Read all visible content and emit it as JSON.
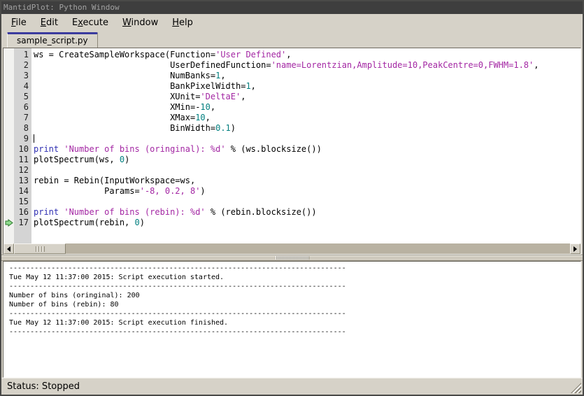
{
  "window": {
    "title": "MantidPlot: Python Window"
  },
  "menu_bar": {
    "items": [
      {
        "name": "file",
        "pre": "",
        "key": "F",
        "post": "ile"
      },
      {
        "name": "edit",
        "pre": "",
        "key": "E",
        "post": "dit"
      },
      {
        "name": "execute",
        "pre": "E",
        "key": "x",
        "post": "ecute"
      },
      {
        "name": "window",
        "pre": "",
        "key": "W",
        "post": "indow"
      },
      {
        "name": "help",
        "pre": "",
        "key": "H",
        "post": "elp"
      }
    ]
  },
  "tabs": {
    "active_label": "sample_script.py"
  },
  "editor": {
    "caret_line": 9,
    "execution_marker_line": 17,
    "colors": {
      "keyword": "#2f2fb2",
      "string": "#a326a3",
      "number": "#007f7f",
      "default": "#000000"
    },
    "lines": [
      {
        "n": 1,
        "seg": [
          [
            "c",
            "ws = CreateSampleWorkspace(Function="
          ],
          [
            "s",
            "'User Defined'"
          ],
          [
            "c",
            ","
          ]
        ]
      },
      {
        "n": 2,
        "seg": [
          [
            "c",
            "                           UserDefinedFunction="
          ],
          [
            "s",
            "'name=Lorentzian,Amplitude=10,PeakCentre=0,FWHM=1.8'"
          ],
          [
            "c",
            ","
          ]
        ]
      },
      {
        "n": 3,
        "seg": [
          [
            "c",
            "                           NumBanks="
          ],
          [
            "n",
            "1"
          ],
          [
            "c",
            ","
          ]
        ]
      },
      {
        "n": 4,
        "seg": [
          [
            "c",
            "                           BankPixelWidth="
          ],
          [
            "n",
            "1"
          ],
          [
            "c",
            ","
          ]
        ]
      },
      {
        "n": 5,
        "seg": [
          [
            "c",
            "                           XUnit="
          ],
          [
            "s",
            "'DeltaE'"
          ],
          [
            "c",
            ","
          ]
        ]
      },
      {
        "n": 6,
        "seg": [
          [
            "c",
            "                           XMin=-"
          ],
          [
            "n",
            "10"
          ],
          [
            "c",
            ","
          ]
        ]
      },
      {
        "n": 7,
        "seg": [
          [
            "c",
            "                           XMax="
          ],
          [
            "n",
            "10"
          ],
          [
            "c",
            ","
          ]
        ]
      },
      {
        "n": 8,
        "seg": [
          [
            "c",
            "                           BinWidth="
          ],
          [
            "n",
            "0.1"
          ],
          [
            "c",
            ")"
          ]
        ]
      },
      {
        "n": 9,
        "seg": [],
        "caret": true
      },
      {
        "n": 10,
        "seg": [
          [
            "k",
            "print"
          ],
          [
            "c",
            " "
          ],
          [
            "s",
            "'Number of bins (oringinal): %d'"
          ],
          [
            "c",
            " % (ws.blocksize())"
          ]
        ]
      },
      {
        "n": 11,
        "seg": [
          [
            "c",
            "plotSpectrum(ws, "
          ],
          [
            "n",
            "0"
          ],
          [
            "c",
            ")"
          ]
        ]
      },
      {
        "n": 12,
        "seg": []
      },
      {
        "n": 13,
        "seg": [
          [
            "c",
            "rebin = Rebin(InputWorkspace=ws,"
          ]
        ]
      },
      {
        "n": 14,
        "seg": [
          [
            "c",
            "              Params="
          ],
          [
            "s",
            "'-8, 0.2, 8'"
          ],
          [
            "c",
            ")"
          ]
        ]
      },
      {
        "n": 15,
        "seg": []
      },
      {
        "n": 16,
        "seg": [
          [
            "k",
            "print"
          ],
          [
            "c",
            " "
          ],
          [
            "s",
            "'Number of bins (rebin): %d'"
          ],
          [
            "c",
            " % (rebin.blocksize())"
          ]
        ]
      },
      {
        "n": 17,
        "seg": [
          [
            "c",
            "plotSpectrum(rebin, "
          ],
          [
            "n",
            "0"
          ],
          [
            "c",
            ")"
          ]
        ],
        "marker": true
      }
    ]
  },
  "output": {
    "lines": [
      "--------------------------------------------------------------------------------",
      "Tue May 12 11:37:00 2015: Script execution started.",
      "--------------------------------------------------------------------------------",
      "Number of bins (oringinal): 200",
      "Number of bins (rebin): 80",
      "--------------------------------------------------------------------------------",
      "Tue May 12 11:37:00 2015: Script execution finished.",
      "--------------------------------------------------------------------------------"
    ]
  },
  "status_bar": {
    "text": "Status: Stopped"
  },
  "ui_colors": {
    "chrome": "#d6d2c8",
    "titlebar_bg": "#3e3e3e",
    "titlebar_text": "#a2a2a2",
    "tab_accent": "#3b3b9e",
    "marker_green_fill": "#90dc8e",
    "marker_green_stroke": "#2d7a2d",
    "scrollbar_track": "#b9b2a2"
  }
}
